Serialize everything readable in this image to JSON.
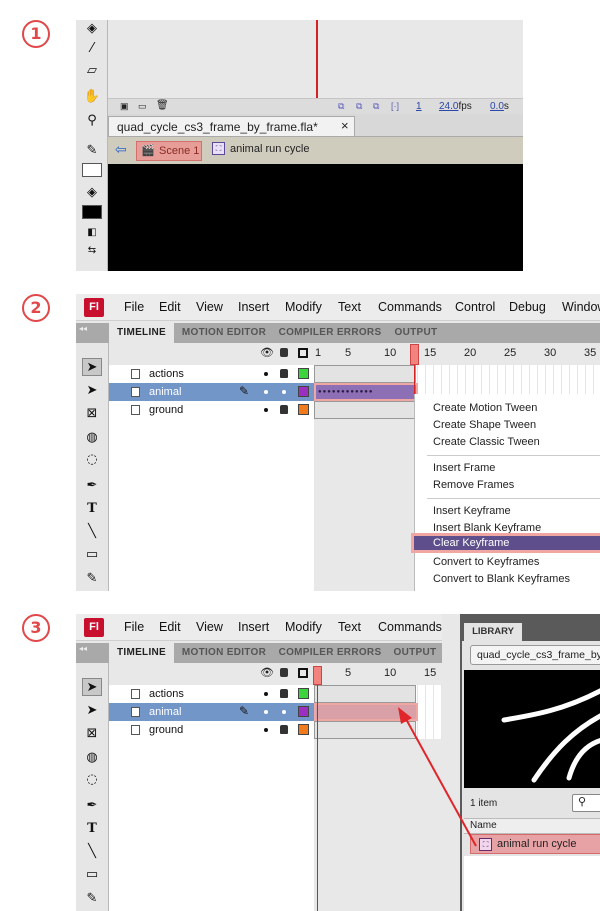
{
  "steps": {
    "s1": "1",
    "s2": "2",
    "s3": "3"
  },
  "panel1": {
    "fps": "24.0",
    "fps_unit": "fps",
    "time": "0.0",
    "time_unit": "s",
    "frame": "1",
    "doc_tab": "quad_cycle_cs3_frame_by_frame.fla*",
    "close": "×",
    "scene": "Scene 1",
    "symbol": "animal run cycle"
  },
  "menu": [
    "Fl",
    "File",
    "Edit",
    "View",
    "Insert",
    "Modify",
    "Text",
    "Commands",
    "Control",
    "Debug",
    "Window"
  ],
  "menu3": [
    "Fl",
    "File",
    "Edit",
    "View",
    "Insert",
    "Modify",
    "Text",
    "Commands"
  ],
  "tabs": [
    "TIMELINE",
    "MOTION EDITOR",
    "COMPILER ERRORS",
    "OUTPUT"
  ],
  "ruler": [
    "1",
    "5",
    "10",
    "15",
    "20",
    "25",
    "30",
    "35"
  ],
  "ruler3": [
    "1",
    "5",
    "10",
    "15"
  ],
  "layers": [
    "actions",
    "animal",
    "ground"
  ],
  "colors": {
    "actions": "#3ed43e",
    "animal": "#9b2fbf",
    "ground": "#f07a1e",
    "selected": "#7396c8",
    "accent": "#e0484a"
  },
  "context_menu": [
    "Create Motion Tween",
    "Create Shape Tween",
    "Create Classic Tween",
    "Insert Frame",
    "Remove Frames",
    "Insert Keyframe",
    "Insert Blank Keyframe",
    "Clear Keyframe",
    "Convert to Keyframes",
    "Convert to Blank Keyframes"
  ],
  "library": {
    "title": "LIBRARY",
    "file": "quad_cycle_cs3_frame_by",
    "count": "1 item",
    "col": "Name",
    "item": "animal run cycle"
  }
}
